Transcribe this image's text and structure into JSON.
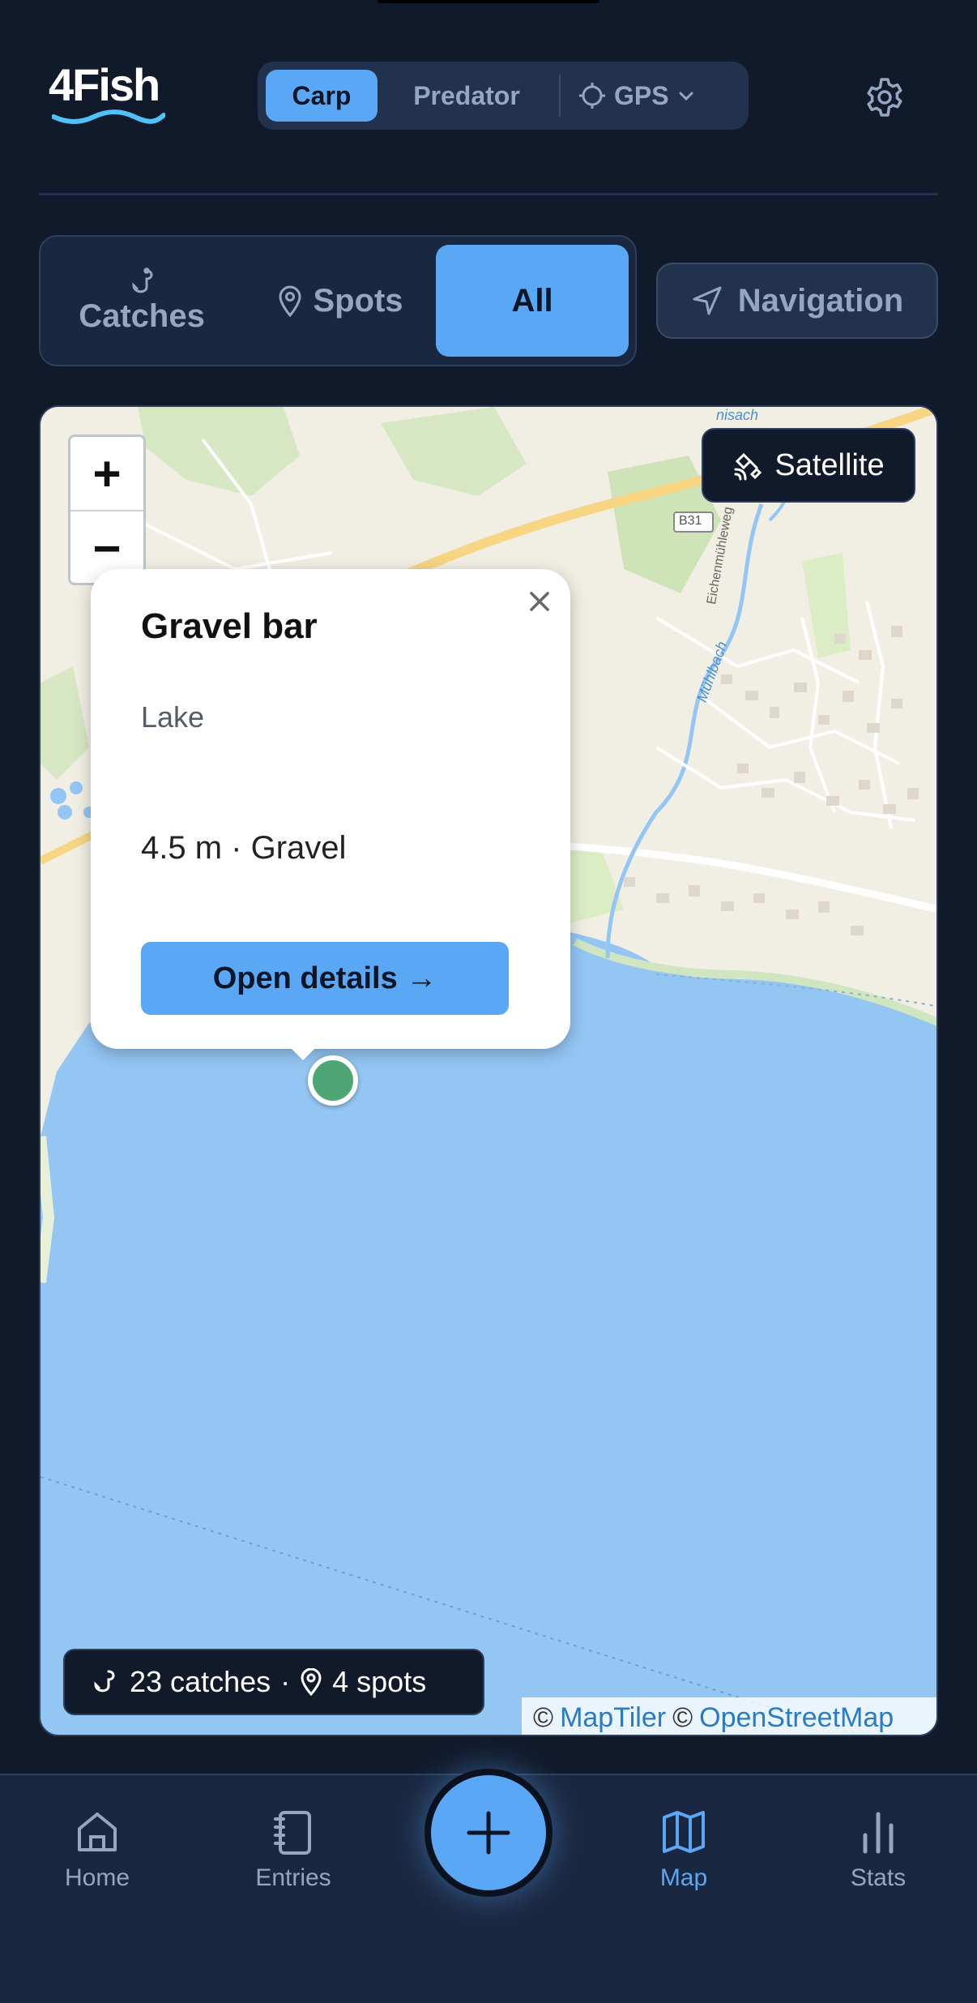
{
  "app": {
    "logo_text": "4Fish"
  },
  "header": {
    "modes": [
      {
        "label": "Carp",
        "active": true
      },
      {
        "label": "Predator",
        "active": false
      }
    ],
    "gps_label": "GPS",
    "settings_icon": "gear-icon"
  },
  "filters": {
    "catches_label": "Catches",
    "spots_label": "Spots",
    "all_label": "All",
    "active": "All",
    "navigation_label": "Navigation"
  },
  "map": {
    "satellite_label": "Satellite",
    "zoom_in": "+",
    "zoom_out": "−",
    "road_label": "B31",
    "street_label": "Eichenmühleweg",
    "stream_label": "Mühlbach",
    "top_label": "nisach",
    "popup": {
      "title": "Gravel bar",
      "type": "Lake",
      "meta": "4.5 m · Gravel",
      "button": "Open details →"
    },
    "summary": {
      "catches": "23 catches",
      "separator": "·",
      "spots": "4 spots"
    },
    "attribution": {
      "c1": "©",
      "maptiler": "MapTiler",
      "c2": "©",
      "osm": "OpenStreetMap"
    },
    "colors": {
      "water": "#94c6f4",
      "land": "#f1efe4",
      "forest": "#cfe3b8",
      "marker": "#4ea674"
    }
  },
  "bottom_nav": {
    "items": [
      {
        "label": "Home",
        "icon": "home-icon"
      },
      {
        "label": "Entries",
        "icon": "notebook-icon"
      },
      {
        "label": "Map",
        "icon": "map-icon",
        "active": true
      },
      {
        "label": "Stats",
        "icon": "bar-chart-icon"
      }
    ],
    "fab_icon": "plus-icon"
  },
  "colors": {
    "background": "#111a2b",
    "accent": "#5aa7f5",
    "muted_text": "#94a6c0"
  }
}
